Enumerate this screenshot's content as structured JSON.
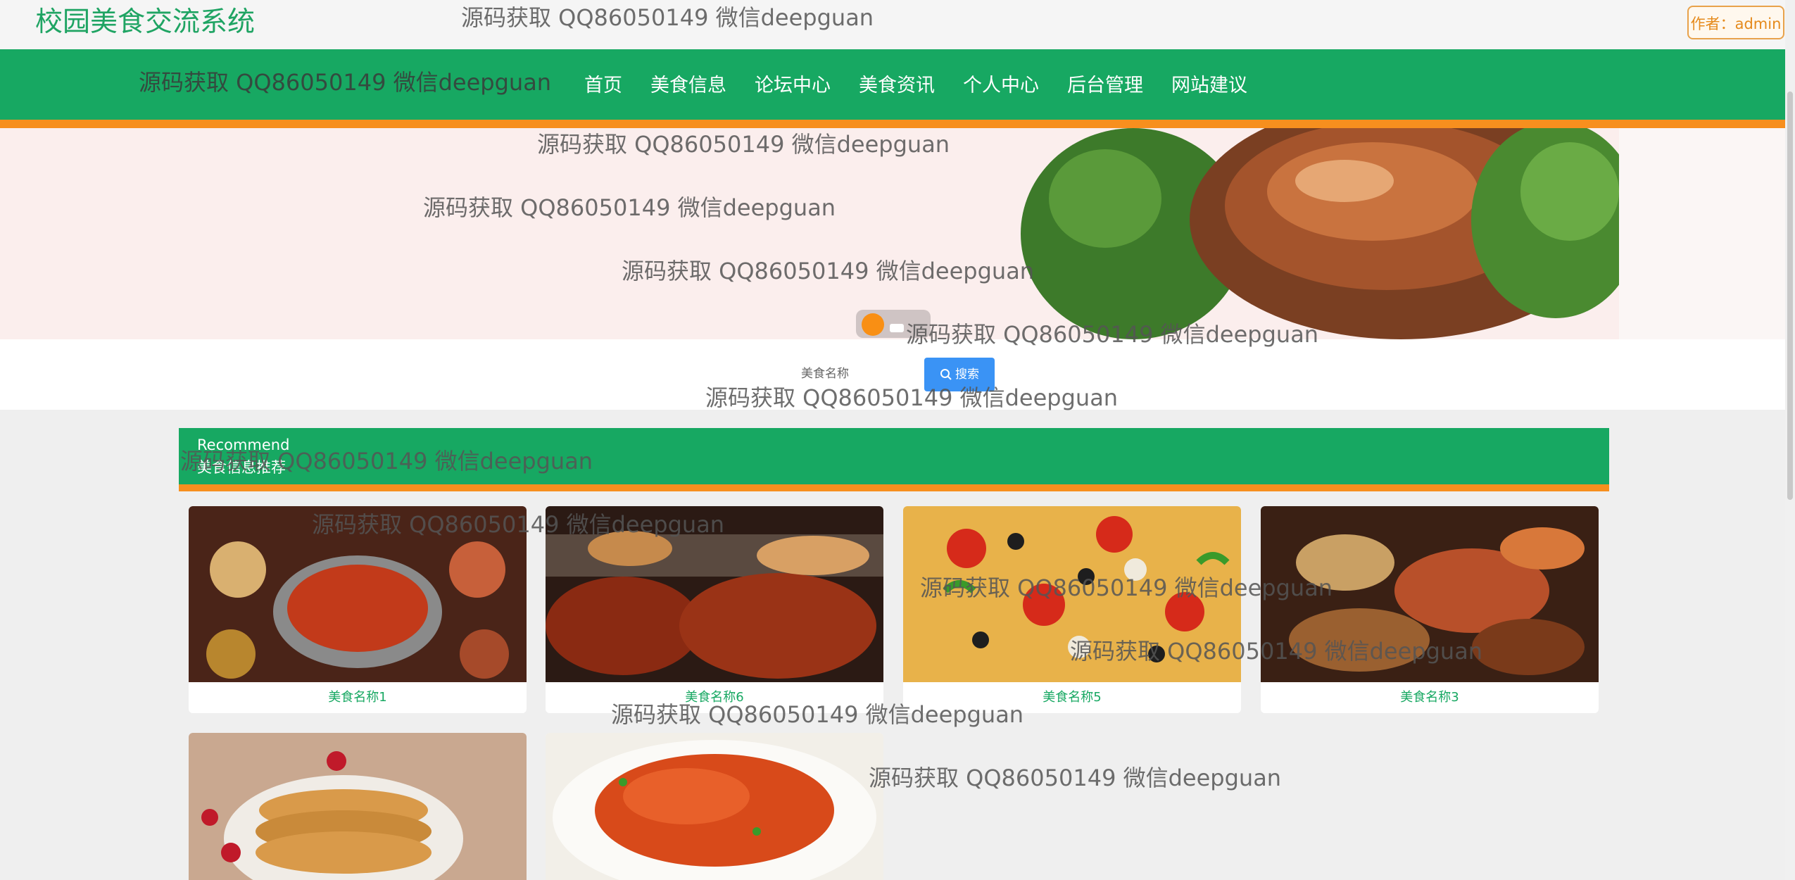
{
  "header": {
    "site_title": "校园美食交流系统",
    "author_label": "作者：admin"
  },
  "nav": {
    "items": [
      "首页",
      "美食信息",
      "论坛中心",
      "美食资讯",
      "个人中心",
      "后台管理",
      "网站建议"
    ]
  },
  "search": {
    "label": "美食名称",
    "button_label": "搜索"
  },
  "section": {
    "title_en": "Recommend",
    "title_cn": "美食信息推荐"
  },
  "cards": [
    {
      "name": "美食名称1"
    },
    {
      "name": "美食名称6"
    },
    {
      "name": "美食名称5"
    },
    {
      "name": "美食名称3"
    },
    {
      "name": ""
    },
    {
      "name": ""
    }
  ],
  "watermark": "源码获取 QQ86050149 微信deepguan",
  "colors": {
    "brand_green": "#17a862",
    "accent_orange": "#f78f1e",
    "search_blue": "#3a93f5"
  }
}
